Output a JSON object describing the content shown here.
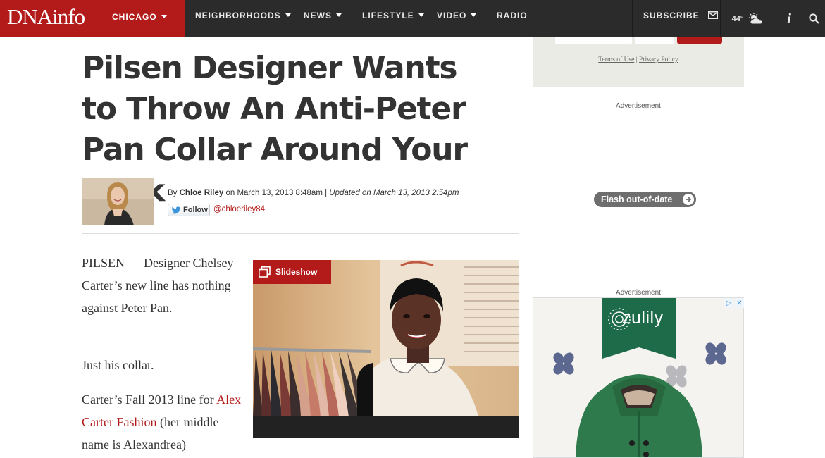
{
  "brand": {
    "logo": "DNAinfo",
    "city": "CHICAGO"
  },
  "nav": {
    "items": [
      "NEIGHBORHOODS",
      "NEWS",
      "LIFESTYLE",
      "VIDEO",
      "RADIO"
    ],
    "subscribe": "SUBSCRIBE",
    "weather_temp": "44°",
    "icons": [
      "mail-icon",
      "partly-cloudy-icon",
      "info-icon",
      "search-icon"
    ]
  },
  "newsletter": {
    "terms": "Terms of Use",
    "separator": " | ",
    "privacy": "Privacy Policy"
  },
  "ads": {
    "label_top": "Advertisement",
    "flash_notice": "Flash out-of-date",
    "label_bottom": "Advertisement",
    "zulily_brand": "zulily"
  },
  "article": {
    "headline": "Pilsen Designer Wants to Throw An Anti-Peter Pan Collar Around Your Neck",
    "byline_prefix": "By ",
    "author": "Chloe Riley",
    "published": " on March 13, 2013 8:48am | ",
    "updated": "Updated on March 13, 2013 2:54pm",
    "follow_label": "Follow",
    "twitter_handle": "@chloeriley84",
    "slideshow_label": "Slideshow",
    "paragraphs": {
      "p1": "PILSEN — Designer Chelsey Carter’s new line has nothing against Peter Pan.",
      "p2": "Just his collar.",
      "p3_start": "Carter’s Fall 2013 line for ",
      "p3_link": "Alex Carter Fashion",
      "p3_end": " (her middle name is Alexandrea)"
    }
  },
  "colors": {
    "brand_red": "#b31b1b",
    "nav_bg": "#2b2b2b",
    "zulily_green": "#1e6b4a"
  }
}
